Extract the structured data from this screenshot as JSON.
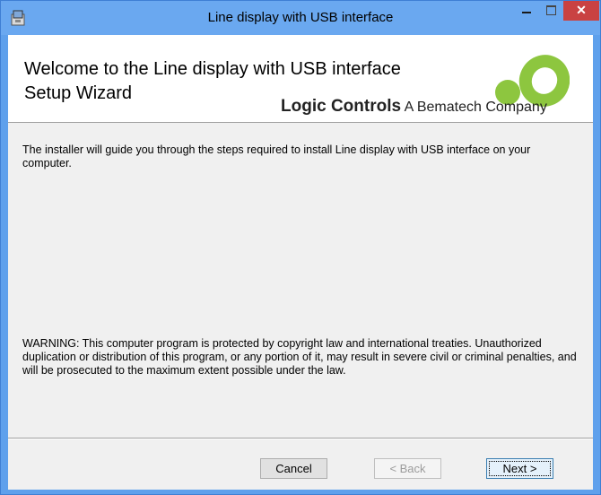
{
  "window": {
    "title": "Line display with USB interface",
    "close_glyph": "✕"
  },
  "banner": {
    "heading_line1": "Welcome to the Line display with USB interface",
    "heading_line2": "Setup Wizard",
    "brand_name": "Logic Controls",
    "brand_tagline": "A Bematech Company",
    "logo_colors": [
      "#8dc63f",
      "#5aa02c"
    ]
  },
  "content": {
    "intro_text": "The installer will guide you through the steps required to install Line display with USB interface on your computer.",
    "warning_text": "WARNING: This computer program is protected by copyright law and international treaties. Unauthorized duplication or distribution of this program, or any portion of it, may result in severe civil or criminal penalties, and will be prosecuted to the maximum extent possible under the law."
  },
  "buttons": {
    "cancel": "Cancel",
    "back": "< Back",
    "next": "Next >"
  }
}
